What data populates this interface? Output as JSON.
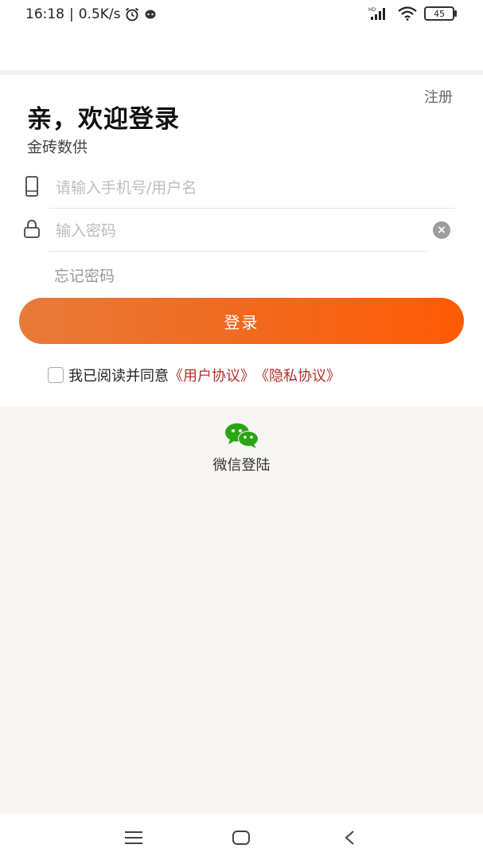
{
  "status_bar": {
    "time": "16:18",
    "separator": "|",
    "speed": "0.5K/s",
    "battery": "45",
    "icons": [
      "alarm-icon",
      "notification-dot-icon",
      "signal-icon",
      "wifi-icon",
      "battery-icon"
    ]
  },
  "header": {
    "register_label": "注册",
    "title": "亲，欢迎登录",
    "subtitle": "金砖数供"
  },
  "form": {
    "username_placeholder": "请输入手机号/用户名",
    "username_value": "",
    "password_placeholder": "输入密码",
    "password_value": "",
    "forgot_label": "忘记密码",
    "login_label": "登录"
  },
  "agreement": {
    "prefix": "我已阅读并同意",
    "user_agreement": "《用户协议》",
    "privacy_agreement": "《隐私协议》",
    "checked": false
  },
  "third_party": {
    "wechat_label": "微信登陆"
  },
  "colors": {
    "accent_start": "#e87a3a",
    "accent_end": "#ff5a05",
    "link": "#b0312a",
    "wechat_green": "#2aa515"
  }
}
